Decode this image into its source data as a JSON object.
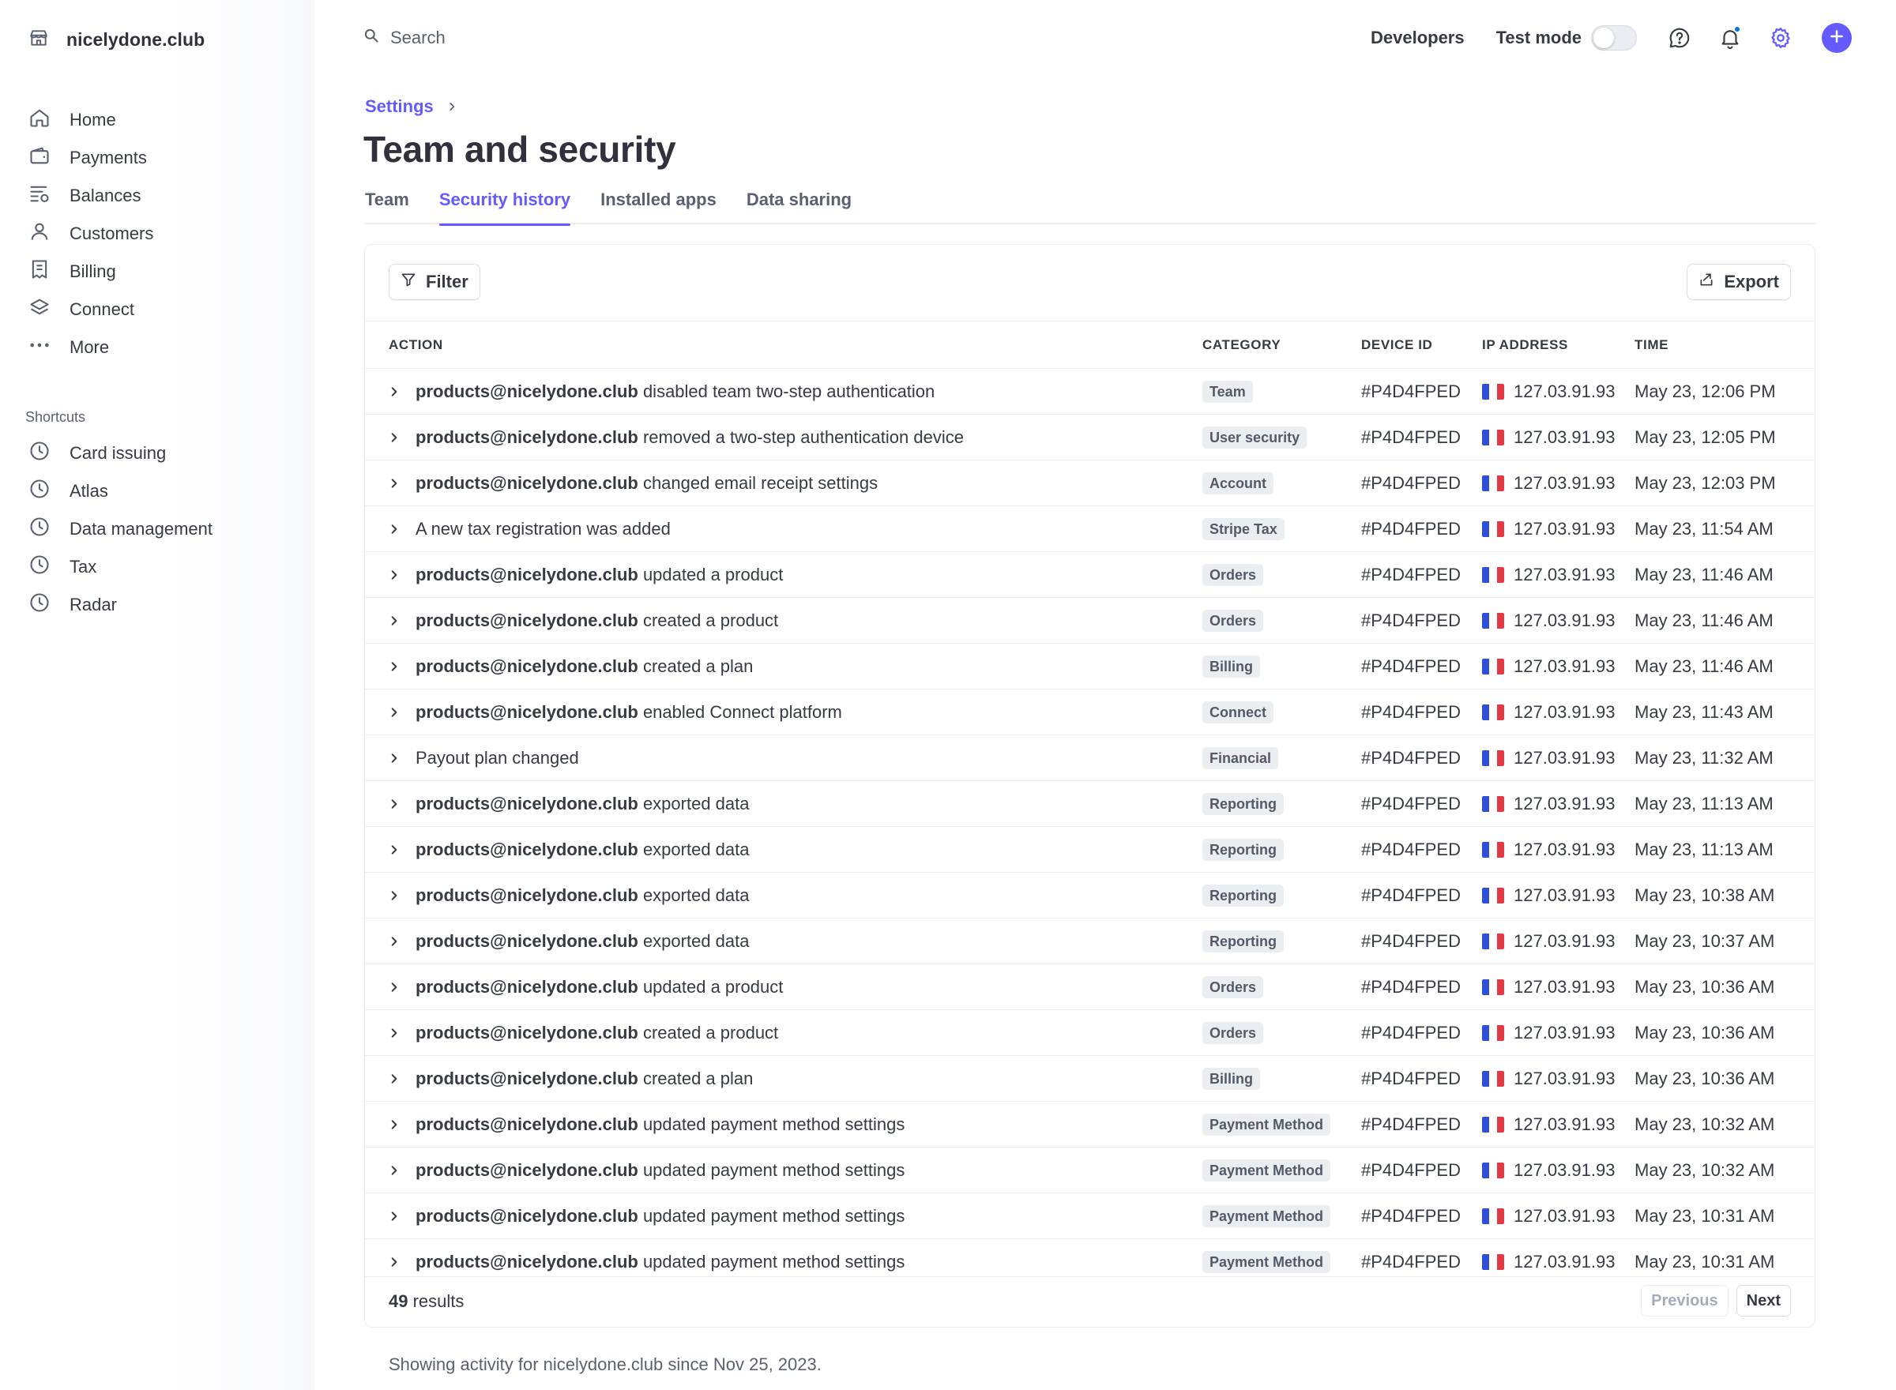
{
  "brand": {
    "name": "nicelydone.club"
  },
  "nav": {
    "items": [
      {
        "label": "Home",
        "icon": "home-icon"
      },
      {
        "label": "Payments",
        "icon": "wallet-icon"
      },
      {
        "label": "Balances",
        "icon": "balances-icon"
      },
      {
        "label": "Customers",
        "icon": "person-icon"
      },
      {
        "label": "Billing",
        "icon": "invoice-icon"
      },
      {
        "label": "Connect",
        "icon": "layers-icon"
      },
      {
        "label": "More",
        "icon": "more-icon"
      }
    ],
    "shortcuts_title": "Shortcuts",
    "shortcuts": [
      {
        "label": "Card issuing",
        "icon": "clock-icon"
      },
      {
        "label": "Atlas",
        "icon": "clock-icon"
      },
      {
        "label": "Data management",
        "icon": "clock-icon"
      },
      {
        "label": "Tax",
        "icon": "clock-icon"
      },
      {
        "label": "Radar",
        "icon": "clock-icon"
      }
    ]
  },
  "topbar": {
    "search_placeholder": "Search",
    "developers": "Developers",
    "test_mode": "Test mode"
  },
  "breadcrumb": {
    "settings": "Settings"
  },
  "page": {
    "title": "Team and security"
  },
  "tabs": [
    {
      "label": "Team",
      "active": false
    },
    {
      "label": "Security history",
      "active": true
    },
    {
      "label": "Installed apps",
      "active": false
    },
    {
      "label": "Data sharing",
      "active": false
    }
  ],
  "toolbar": {
    "filter": "Filter",
    "export": "Export"
  },
  "table": {
    "headers": {
      "action": "Action",
      "category": "Category",
      "device": "Device ID",
      "ip": "IP address",
      "time": "Time"
    },
    "rows": [
      {
        "user": "products@nicelydone.club",
        "action": " disabled team two-step authentication",
        "category": "Team",
        "device": "#P4D4FPED",
        "ip": "127.03.91.93",
        "time": "May 23, 12:06 PM"
      },
      {
        "user": "products@nicelydone.club",
        "action": " removed a two-step authentication device",
        "category": "User security",
        "device": "#P4D4FPED",
        "ip": "127.03.91.93",
        "time": "May 23, 12:05 PM"
      },
      {
        "user": "products@nicelydone.club",
        "action": " changed email receipt settings",
        "category": "Account",
        "device": "#P4D4FPED",
        "ip": "127.03.91.93",
        "time": "May 23, 12:03 PM"
      },
      {
        "user": "",
        "action": "A new tax registration was added",
        "category": "Stripe Tax",
        "device": "#P4D4FPED",
        "ip": "127.03.91.93",
        "time": "May 23, 11:54 AM"
      },
      {
        "user": "products@nicelydone.club",
        "action": " updated a product",
        "category": "Orders",
        "device": "#P4D4FPED",
        "ip": "127.03.91.93",
        "time": "May 23, 11:46 AM"
      },
      {
        "user": "products@nicelydone.club",
        "action": " created a product",
        "category": "Orders",
        "device": "#P4D4FPED",
        "ip": "127.03.91.93",
        "time": "May 23, 11:46 AM"
      },
      {
        "user": "products@nicelydone.club",
        "action": " created a plan",
        "category": "Billing",
        "device": "#P4D4FPED",
        "ip": "127.03.91.93",
        "time": "May 23, 11:46 AM"
      },
      {
        "user": "products@nicelydone.club",
        "action": " enabled Connect platform",
        "category": "Connect",
        "device": "#P4D4FPED",
        "ip": "127.03.91.93",
        "time": "May 23, 11:43 AM"
      },
      {
        "user": "",
        "action": "Payout plan changed",
        "category": "Financial",
        "device": "#P4D4FPED",
        "ip": "127.03.91.93",
        "time": "May 23, 11:32 AM"
      },
      {
        "user": "products@nicelydone.club",
        "action": " exported data",
        "category": "Reporting",
        "device": "#P4D4FPED",
        "ip": "127.03.91.93",
        "time": "May 23, 11:13 AM"
      },
      {
        "user": "products@nicelydone.club",
        "action": " exported data",
        "category": "Reporting",
        "device": "#P4D4FPED",
        "ip": "127.03.91.93",
        "time": "May 23, 11:13 AM"
      },
      {
        "user": "products@nicelydone.club",
        "action": " exported data",
        "category": "Reporting",
        "device": "#P4D4FPED",
        "ip": "127.03.91.93",
        "time": "May 23, 10:38 AM"
      },
      {
        "user": "products@nicelydone.club",
        "action": " exported data",
        "category": "Reporting",
        "device": "#P4D4FPED",
        "ip": "127.03.91.93",
        "time": "May 23, 10:37 AM"
      },
      {
        "user": "products@nicelydone.club",
        "action": " updated a product",
        "category": "Orders",
        "device": "#P4D4FPED",
        "ip": "127.03.91.93",
        "time": "May 23, 10:36 AM"
      },
      {
        "user": "products@nicelydone.club",
        "action": " created a product",
        "category": "Orders",
        "device": "#P4D4FPED",
        "ip": "127.03.91.93",
        "time": "May 23, 10:36 AM"
      },
      {
        "user": "products@nicelydone.club",
        "action": " created a plan",
        "category": "Billing",
        "device": "#P4D4FPED",
        "ip": "127.03.91.93",
        "time": "May 23, 10:36 AM"
      },
      {
        "user": "products@nicelydone.club",
        "action": " updated payment method settings",
        "category": "Payment Method",
        "device": "#P4D4FPED",
        "ip": "127.03.91.93",
        "time": "May 23, 10:32 AM"
      },
      {
        "user": "products@nicelydone.club",
        "action": " updated payment method settings",
        "category": "Payment Method",
        "device": "#P4D4FPED",
        "ip": "127.03.91.93",
        "time": "May 23, 10:32 AM"
      },
      {
        "user": "products@nicelydone.club",
        "action": " updated payment method settings",
        "category": "Payment Method",
        "device": "#P4D4FPED",
        "ip": "127.03.91.93",
        "time": "May 23, 10:31 AM"
      },
      {
        "user": "products@nicelydone.club",
        "action": " updated payment method settings",
        "category": "Payment Method",
        "device": "#P4D4FPED",
        "ip": "127.03.91.93",
        "time": "May 23, 10:31 AM"
      }
    ]
  },
  "footer": {
    "results_count": "49",
    "results_label": " results",
    "previous": "Previous",
    "next": "Next"
  },
  "activity_note": "Showing activity for nicelydone.club since Nov 25, 2023.",
  "colors": {
    "accent": "#635bff",
    "flag_blue": "#2f4fd6",
    "flag_white": "#ffffff",
    "flag_red": "#e03b45"
  }
}
